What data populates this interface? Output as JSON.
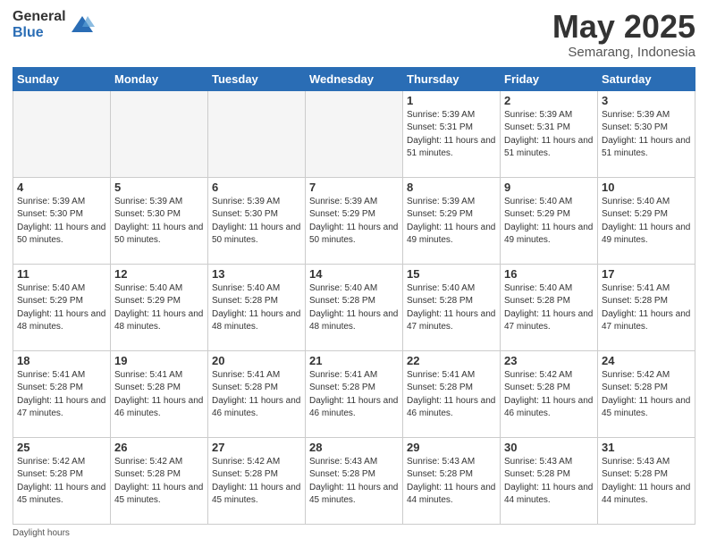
{
  "header": {
    "logo_general": "General",
    "logo_blue": "Blue",
    "title": "May 2025",
    "subtitle": "Semarang, Indonesia"
  },
  "days_of_week": [
    "Sunday",
    "Monday",
    "Tuesday",
    "Wednesday",
    "Thursday",
    "Friday",
    "Saturday"
  ],
  "footer": {
    "label": "Daylight hours"
  },
  "weeks": [
    [
      {
        "day": "",
        "empty": true
      },
      {
        "day": "",
        "empty": true
      },
      {
        "day": "",
        "empty": true
      },
      {
        "day": "",
        "empty": true
      },
      {
        "day": "1",
        "sunrise": "Sunrise: 5:39 AM",
        "sunset": "Sunset: 5:31 PM",
        "daylight": "Daylight: 11 hours and 51 minutes."
      },
      {
        "day": "2",
        "sunrise": "Sunrise: 5:39 AM",
        "sunset": "Sunset: 5:31 PM",
        "daylight": "Daylight: 11 hours and 51 minutes."
      },
      {
        "day": "3",
        "sunrise": "Sunrise: 5:39 AM",
        "sunset": "Sunset: 5:30 PM",
        "daylight": "Daylight: 11 hours and 51 minutes."
      }
    ],
    [
      {
        "day": "4",
        "sunrise": "Sunrise: 5:39 AM",
        "sunset": "Sunset: 5:30 PM",
        "daylight": "Daylight: 11 hours and 50 minutes."
      },
      {
        "day": "5",
        "sunrise": "Sunrise: 5:39 AM",
        "sunset": "Sunset: 5:30 PM",
        "daylight": "Daylight: 11 hours and 50 minutes."
      },
      {
        "day": "6",
        "sunrise": "Sunrise: 5:39 AM",
        "sunset": "Sunset: 5:30 PM",
        "daylight": "Daylight: 11 hours and 50 minutes."
      },
      {
        "day": "7",
        "sunrise": "Sunrise: 5:39 AM",
        "sunset": "Sunset: 5:29 PM",
        "daylight": "Daylight: 11 hours and 50 minutes."
      },
      {
        "day": "8",
        "sunrise": "Sunrise: 5:39 AM",
        "sunset": "Sunset: 5:29 PM",
        "daylight": "Daylight: 11 hours and 49 minutes."
      },
      {
        "day": "9",
        "sunrise": "Sunrise: 5:40 AM",
        "sunset": "Sunset: 5:29 PM",
        "daylight": "Daylight: 11 hours and 49 minutes."
      },
      {
        "day": "10",
        "sunrise": "Sunrise: 5:40 AM",
        "sunset": "Sunset: 5:29 PM",
        "daylight": "Daylight: 11 hours and 49 minutes."
      }
    ],
    [
      {
        "day": "11",
        "sunrise": "Sunrise: 5:40 AM",
        "sunset": "Sunset: 5:29 PM",
        "daylight": "Daylight: 11 hours and 48 minutes."
      },
      {
        "day": "12",
        "sunrise": "Sunrise: 5:40 AM",
        "sunset": "Sunset: 5:29 PM",
        "daylight": "Daylight: 11 hours and 48 minutes."
      },
      {
        "day": "13",
        "sunrise": "Sunrise: 5:40 AM",
        "sunset": "Sunset: 5:28 PM",
        "daylight": "Daylight: 11 hours and 48 minutes."
      },
      {
        "day": "14",
        "sunrise": "Sunrise: 5:40 AM",
        "sunset": "Sunset: 5:28 PM",
        "daylight": "Daylight: 11 hours and 48 minutes."
      },
      {
        "day": "15",
        "sunrise": "Sunrise: 5:40 AM",
        "sunset": "Sunset: 5:28 PM",
        "daylight": "Daylight: 11 hours and 47 minutes."
      },
      {
        "day": "16",
        "sunrise": "Sunrise: 5:40 AM",
        "sunset": "Sunset: 5:28 PM",
        "daylight": "Daylight: 11 hours and 47 minutes."
      },
      {
        "day": "17",
        "sunrise": "Sunrise: 5:41 AM",
        "sunset": "Sunset: 5:28 PM",
        "daylight": "Daylight: 11 hours and 47 minutes."
      }
    ],
    [
      {
        "day": "18",
        "sunrise": "Sunrise: 5:41 AM",
        "sunset": "Sunset: 5:28 PM",
        "daylight": "Daylight: 11 hours and 47 minutes."
      },
      {
        "day": "19",
        "sunrise": "Sunrise: 5:41 AM",
        "sunset": "Sunset: 5:28 PM",
        "daylight": "Daylight: 11 hours and 46 minutes."
      },
      {
        "day": "20",
        "sunrise": "Sunrise: 5:41 AM",
        "sunset": "Sunset: 5:28 PM",
        "daylight": "Daylight: 11 hours and 46 minutes."
      },
      {
        "day": "21",
        "sunrise": "Sunrise: 5:41 AM",
        "sunset": "Sunset: 5:28 PM",
        "daylight": "Daylight: 11 hours and 46 minutes."
      },
      {
        "day": "22",
        "sunrise": "Sunrise: 5:41 AM",
        "sunset": "Sunset: 5:28 PM",
        "daylight": "Daylight: 11 hours and 46 minutes."
      },
      {
        "day": "23",
        "sunrise": "Sunrise: 5:42 AM",
        "sunset": "Sunset: 5:28 PM",
        "daylight": "Daylight: 11 hours and 46 minutes."
      },
      {
        "day": "24",
        "sunrise": "Sunrise: 5:42 AM",
        "sunset": "Sunset: 5:28 PM",
        "daylight": "Daylight: 11 hours and 45 minutes."
      }
    ],
    [
      {
        "day": "25",
        "sunrise": "Sunrise: 5:42 AM",
        "sunset": "Sunset: 5:28 PM",
        "daylight": "Daylight: 11 hours and 45 minutes."
      },
      {
        "day": "26",
        "sunrise": "Sunrise: 5:42 AM",
        "sunset": "Sunset: 5:28 PM",
        "daylight": "Daylight: 11 hours and 45 minutes."
      },
      {
        "day": "27",
        "sunrise": "Sunrise: 5:42 AM",
        "sunset": "Sunset: 5:28 PM",
        "daylight": "Daylight: 11 hours and 45 minutes."
      },
      {
        "day": "28",
        "sunrise": "Sunrise: 5:43 AM",
        "sunset": "Sunset: 5:28 PM",
        "daylight": "Daylight: 11 hours and 45 minutes."
      },
      {
        "day": "29",
        "sunrise": "Sunrise: 5:43 AM",
        "sunset": "Sunset: 5:28 PM",
        "daylight": "Daylight: 11 hours and 44 minutes."
      },
      {
        "day": "30",
        "sunrise": "Sunrise: 5:43 AM",
        "sunset": "Sunset: 5:28 PM",
        "daylight": "Daylight: 11 hours and 44 minutes."
      },
      {
        "day": "31",
        "sunrise": "Sunrise: 5:43 AM",
        "sunset": "Sunset: 5:28 PM",
        "daylight": "Daylight: 11 hours and 44 minutes."
      }
    ]
  ]
}
